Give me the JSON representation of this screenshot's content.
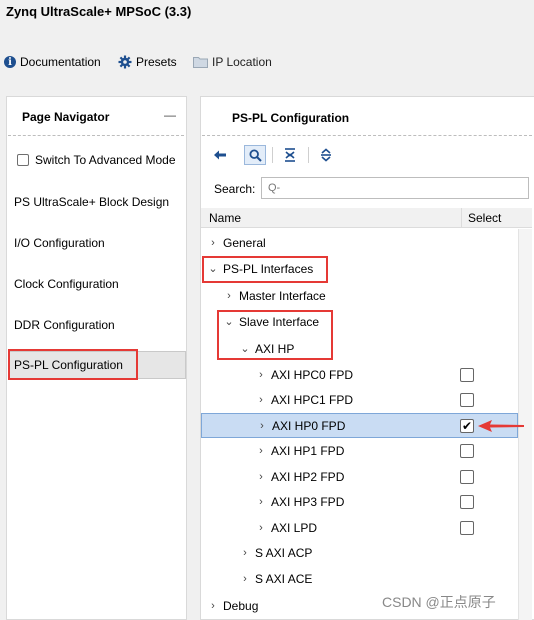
{
  "window": {
    "title": "Zynq UltraScale+ MPSoC (3.3)"
  },
  "toolbar": {
    "documentation": "Documentation",
    "presets": "Presets",
    "ip_location": "IP Location"
  },
  "navigator": {
    "title": "Page Navigator",
    "collapse": "—",
    "switch_mode": "Switch To Advanced Mode",
    "items": [
      {
        "label": "PS UltraScale+ Block Design"
      },
      {
        "label": "I/O Configuration"
      },
      {
        "label": "Clock Configuration"
      },
      {
        "label": "DDR Configuration"
      },
      {
        "label": "PS-PL Configuration",
        "selected": true
      }
    ]
  },
  "config": {
    "title": "PS-PL Configuration",
    "search_label": "Search:",
    "search_placeholder": "Q-",
    "columns": {
      "name": "Name",
      "select": "Select"
    },
    "tree": [
      {
        "label": "General",
        "expanded": false
      },
      {
        "label": "PS-PL Interfaces",
        "expanded": true
      },
      {
        "label": "Master Interface",
        "expanded": false
      },
      {
        "label": "Slave Interface",
        "expanded": true
      },
      {
        "label": "AXI HP",
        "expanded": true
      },
      {
        "label": "AXI HPC0 FPD",
        "checked": false
      },
      {
        "label": "AXI HPC1 FPD",
        "checked": false
      },
      {
        "label": "AXI HP0 FPD",
        "checked": true,
        "selected": true
      },
      {
        "label": "AXI HP1 FPD",
        "checked": false
      },
      {
        "label": "AXI HP2 FPD",
        "checked": false
      },
      {
        "label": "AXI HP3 FPD",
        "checked": false
      },
      {
        "label": "AXI LPD",
        "checked": false
      },
      {
        "label": "S AXI ACP",
        "expanded": false
      },
      {
        "label": "S AXI ACE",
        "expanded": false
      },
      {
        "label": "Debug",
        "expanded": false
      }
    ],
    "check_mark": "✔"
  },
  "watermark": "CSDN @正点原子",
  "colors": {
    "accent": "#1e4f8f",
    "highlight": "#e53935",
    "selection": "#c9dcf3"
  }
}
